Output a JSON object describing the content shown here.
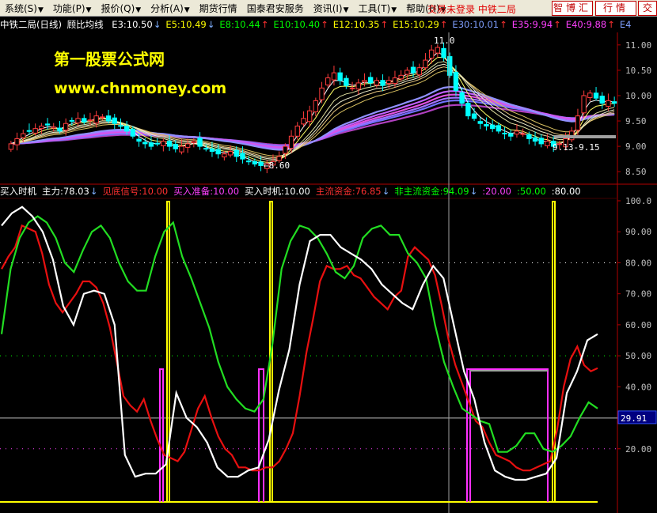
{
  "menu": [
    {
      "label": "系统(S)",
      "arrow": "▼"
    },
    {
      "label": "功能(P)",
      "arrow": "▼"
    },
    {
      "label": "报价(Q)",
      "arrow": "▼"
    },
    {
      "label": "分析(A)",
      "arrow": "▼"
    },
    {
      "label": "期货行情",
      "arrow": ""
    },
    {
      "label": "国泰君安服务",
      "arrow": ""
    },
    {
      "label": "资讯(I)",
      "arrow": "▼"
    },
    {
      "label": "工具(T)",
      "arrow": "▼"
    },
    {
      "label": "帮助(H)",
      "arrow": "▼"
    }
  ],
  "login_status": "交易未登录  中铁二局",
  "buttons": {
    "zhihui": "智博汇",
    "hangqing": "行情",
    "extra": "交"
  },
  "main_chart": {
    "title": "中铁二局(日线)",
    "indicator_name": "顾比均线",
    "ma_lines": [
      {
        "label": "E3:10.50",
        "dir": "↓",
        "color": "#ffffff"
      },
      {
        "label": "E5:10.49",
        "dir": "↓",
        "color": "#ffff00"
      },
      {
        "label": "E8:10.44",
        "dir": "↑",
        "color": "#00ff00"
      },
      {
        "label": "E10:10.40",
        "dir": "↑",
        "color": "#00ff00"
      },
      {
        "label": "E12:10.35",
        "dir": "↑",
        "color": "#ffff00"
      },
      {
        "label": "E15:10.29",
        "dir": "↑",
        "color": "#ffff00"
      },
      {
        "label": "E30:10.01",
        "dir": "↑",
        "color": "#7f9fff"
      },
      {
        "label": "E35:9.94",
        "dir": "↑",
        "color": "#ff40ff"
      },
      {
        "label": "E40:9.88",
        "dir": "↑",
        "color": "#ff40ff"
      },
      {
        "label": "E4",
        "dir": "",
        "color": "#7f9fff"
      }
    ],
    "y_ticks": [
      "11.00",
      "10.50",
      "10.00",
      "9.50",
      "9.00",
      "8.50"
    ],
    "annotations": {
      "high": "11.0",
      "low": "←8.60",
      "range": "9.13-9.15"
    },
    "watermark_title": "第一股票公式网",
    "watermark_url": "www.chnmoney.com"
  },
  "indicator_panel": {
    "items": [
      {
        "label": "买入时机",
        "color": "#ffffff"
      },
      {
        "label": "主力:78.03",
        "dir": "↓",
        "color": "#ffffff"
      },
      {
        "label": "见底信号:10.00",
        "color": "#ff3030"
      },
      {
        "label": "买入准备:10.00",
        "color": "#ff40ff"
      },
      {
        "label": "买入时机:10.00",
        "color": "#ffffff"
      },
      {
        "label": "主流资金:76.85",
        "dir": "↓",
        "color": "#ff3030"
      },
      {
        "label": "非主流资金:94.09",
        "dir": "↓",
        "color": "#00ff00"
      },
      {
        "label": ":20.00",
        "color": "#ff40ff"
      },
      {
        "label": ":50.00",
        "color": "#00ff00"
      },
      {
        "label": ":80.00",
        "color": "#ffffff"
      }
    ],
    "y_ticks": [
      "100.0",
      "90.00",
      "80.00",
      "70.00",
      "60.00",
      "50.00",
      "40.00",
      "30.00",
      "20.00"
    ],
    "cursor_value": "29.91",
    "colors": {
      "main_fund": "#e81010",
      "non_main_fund": "#22dd22",
      "buy_time": "#ffffff",
      "signal": "#ffff00",
      "prepare": "#ff30ff"
    }
  },
  "chart_data": [
    {
      "type": "candlestick",
      "title": "中铁二局(日线)",
      "ylim": [
        8.3,
        11.2
      ],
      "close": [
        9.05,
        9.15,
        9.25,
        9.3,
        9.35,
        9.4,
        9.42,
        9.38,
        9.3,
        9.45,
        9.5,
        9.55,
        9.48,
        9.52,
        9.6,
        9.58,
        9.5,
        9.45,
        9.4,
        9.3,
        9.2,
        9.1,
        9.05,
        9.0,
        9.05,
        9.1,
        9.0,
        8.95,
        9.0,
        9.05,
        9.1,
        9.0,
        8.95,
        8.9,
        8.85,
        8.85,
        8.9,
        8.8,
        8.75,
        8.7,
        8.65,
        8.62,
        8.65,
        8.7,
        8.8,
        9.0,
        9.2,
        9.4,
        9.55,
        9.7,
        9.9,
        10.15,
        10.35,
        10.45,
        10.3,
        10.2,
        10.15,
        10.25,
        10.3,
        10.25,
        10.3,
        10.2,
        10.3,
        10.35,
        10.4,
        10.5,
        10.45,
        10.55,
        10.7,
        10.9,
        10.95,
        10.75,
        10.4,
        10.1,
        9.85,
        9.6,
        9.55,
        9.45,
        9.4,
        9.35,
        9.3,
        9.25,
        9.2,
        9.3,
        9.25,
        9.15,
        9.1,
        9.05,
        9.1,
        9.0,
        9.05,
        9.15,
        9.3,
        9.6,
        10.0,
        10.05,
        9.95,
        9.85,
        9.9,
        9.85
      ]
    },
    {
      "type": "line",
      "ylim": [
        10,
        100
      ],
      "series": [
        {
          "name": "主流资金",
          "values": [
            78,
            82,
            85,
            92,
            91,
            90,
            83,
            73,
            67,
            64,
            67,
            70,
            74,
            74,
            72,
            67,
            59,
            48,
            37,
            34,
            32,
            36,
            29,
            23,
            18,
            17,
            16,
            19,
            26,
            33,
            37,
            30,
            24,
            20,
            18,
            14,
            14,
            13,
            13,
            14,
            14,
            16,
            20,
            25,
            37,
            51,
            62,
            74,
            79,
            78,
            78,
            79,
            76,
            75,
            72,
            69,
            67,
            65,
            69,
            71,
            82,
            85,
            83,
            81,
            76,
            66,
            55,
            47,
            41,
            35,
            29,
            27,
            22,
            18,
            17,
            16,
            14,
            13,
            13,
            14,
            15,
            16,
            26,
            40,
            49,
            53,
            47,
            45,
            46
          ]
        },
        {
          "name": "非主流资金",
          "values": [
            57,
            78,
            88,
            93,
            95,
            93,
            88,
            80,
            77,
            84,
            90,
            92,
            88,
            80,
            74,
            71,
            71,
            82,
            90,
            93,
            82,
            75,
            67,
            59,
            48,
            40,
            36,
            33,
            32,
            36,
            54,
            78,
            87,
            92,
            91,
            88,
            83,
            77,
            75,
            79,
            88,
            91,
            92,
            89,
            89,
            83,
            80,
            75,
            60,
            48,
            40,
            33,
            31,
            29,
            28,
            19,
            19,
            21,
            25,
            25,
            20,
            19,
            21,
            24,
            30,
            35,
            33
          ]
        },
        {
          "name": "买入时机",
          "values": [
            92,
            96,
            98,
            95,
            90,
            81,
            66,
            60,
            70,
            71,
            70,
            60,
            18,
            11,
            12,
            12,
            15,
            38,
            30,
            27,
            22,
            14,
            11,
            11,
            13,
            14,
            23,
            39,
            52,
            73,
            87,
            89,
            89,
            85,
            83,
            81,
            78,
            73,
            70,
            67,
            65,
            73,
            79,
            75,
            60,
            45,
            36,
            22,
            13,
            11,
            10,
            10,
            11,
            12,
            17,
            38,
            45,
            55,
            57
          ]
        }
      ]
    }
  ]
}
